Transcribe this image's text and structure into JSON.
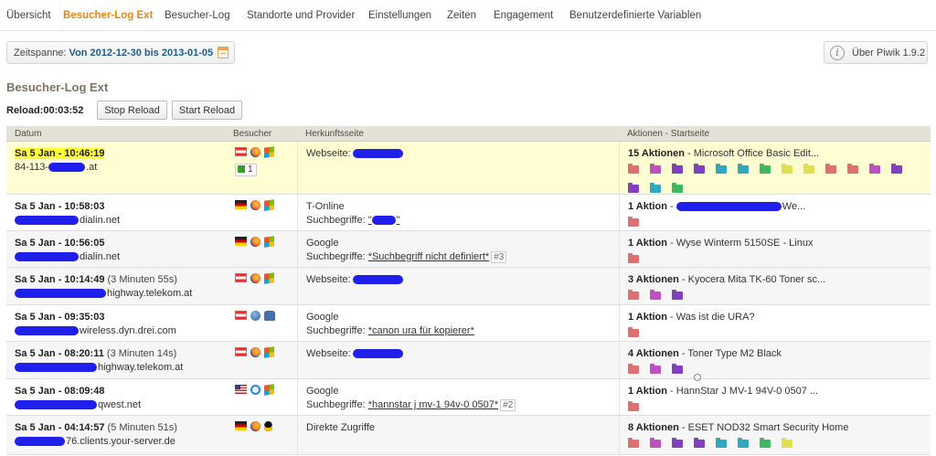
{
  "nav": {
    "tabs": [
      {
        "label": "Übersicht"
      },
      {
        "label": "Besucher-Log Ext"
      },
      {
        "label": "Besucher-Log"
      },
      {
        "label": "Standorte und Provider"
      },
      {
        "label": "Einstellungen"
      },
      {
        "label": "Zeiten"
      },
      {
        "label": "Engagement"
      },
      {
        "label": "Benutzerdefinierte Variablen"
      }
    ],
    "active_tab": "Besucher-Log Ext"
  },
  "period": {
    "label": "Zeitspanne:",
    "value": "Von 2012-12-30 bis 2013-01-05",
    "icon": "calendar-icon"
  },
  "about": {
    "label": "Über Piwik 1.9.2",
    "icon": "info-icon"
  },
  "title": "Besucher-Log Ext",
  "reload": {
    "label": "Reload:",
    "timer": "00:03:52",
    "stop_label": "Stop Reload",
    "start_label": "Start Reload"
  },
  "table": {
    "columns": [
      "Datum",
      "Besucher",
      "Herkunftsseite",
      "Aktionen - Startseite"
    ],
    "rows": [
      {
        "date": "Sa 5 Jan - 10:46:19",
        "duration": "",
        "host": "84-113-",
        "host_suffix": ".at",
        "icons": [
          "flag-at",
          "firefox-icon",
          "windows-icon"
        ],
        "goal": "1",
        "ref_type": "Webseite:",
        "ref_detail": "",
        "keyword": "",
        "pos": "",
        "actions": "15 Aktionen",
        "action_title": "Microsoft Office Basic Edit...",
        "folders": [
          "#e07070",
          "#c050c0",
          "#8040c0",
          "#8040c0",
          "#30a8c0",
          "#30a8c0",
          "#40b860",
          "#e0e050",
          "#e0e050",
          "#e07070",
          "#e07070",
          "#c050c0",
          "#8040c0",
          "#8040c0",
          "#30a8c0",
          "#40b860"
        ],
        "magnifier": false
      },
      {
        "date": "Sa 5 Jan - 10:58:03",
        "duration": "",
        "host": "",
        "host_suffix": "dialin.net",
        "icons": [
          "flag-de",
          "firefox-icon",
          "windows-icon"
        ],
        "goal": "",
        "ref_type": "T-Online",
        "ref_detail": "Suchbegriffe:",
        "keyword": "",
        "pos": "",
        "actions": "1 Aktion",
        "action_title": "We...",
        "folders": [
          "#e07070"
        ],
        "magnifier": false
      },
      {
        "date": "Sa 5 Jan - 10:56:05",
        "duration": "",
        "host": "",
        "host_suffix": "dialin.net",
        "icons": [
          "flag-de",
          "firefox-icon",
          "windows-icon"
        ],
        "goal": "",
        "ref_type": "Google",
        "ref_detail": "Suchbegriffe:",
        "keyword": "*Suchbegriff nicht definiert*",
        "pos": "3",
        "actions": "1 Aktion",
        "action_title": "Wyse Winterm 5150SE - Linux",
        "folders": [
          "#e07070"
        ],
        "magnifier": false
      },
      {
        "date": "Sa 5 Jan - 10:14:49",
        "duration": "(3 Minuten 55s)",
        "host": "",
        "host_suffix": "highway.telekom.at",
        "icons": [
          "flag-at",
          "firefox-icon",
          "windows-icon"
        ],
        "goal": "",
        "ref_type": "Webseite:",
        "ref_detail": "",
        "keyword": "",
        "pos": "",
        "actions": "3 Aktionen",
        "action_title": "Kyocera Mita TK-60 Toner sc...",
        "folders": [
          "#e07070",
          "#c050c0",
          "#8040c0"
        ],
        "magnifier": false
      },
      {
        "date": "Sa 5 Jan - 09:35:03",
        "duration": "",
        "host": "",
        "host_suffix": "wireless.dyn.drei.com",
        "icons": [
          "flag-at",
          "globe-icon",
          "android-icon"
        ],
        "goal": "",
        "ref_type": "Google",
        "ref_detail": "Suchbegriffe:",
        "keyword": "*canon ura für kopierer*",
        "pos": "",
        "actions": "1 Aktion",
        "action_title": "Was ist die URA?",
        "folders": [
          "#e07070"
        ],
        "magnifier": false
      },
      {
        "date": "Sa 5 Jan - 08:20:11",
        "duration": "(3 Minuten 14s)",
        "host": "",
        "host_suffix": "highway.telekom.at",
        "icons": [
          "flag-at",
          "firefox-icon",
          "windows-icon"
        ],
        "goal": "",
        "ref_type": "Webseite:",
        "ref_detail": "",
        "keyword": "",
        "pos": "",
        "actions": "4 Aktionen",
        "action_title": "Toner Type M2 Black",
        "folders": [
          "#e07070",
          "#c050c0",
          "#8040c0"
        ],
        "magnifier": true
      },
      {
        "date": "Sa 5 Jan - 08:09:48",
        "duration": "",
        "host": "",
        "host_suffix": "qwest.net",
        "icons": [
          "flag-us",
          "ie-icon",
          "windows-icon"
        ],
        "goal": "",
        "ref_type": "Google",
        "ref_detail": "Suchbegriffe:",
        "keyword": "*hannstar j mv-1 94v-0 0507*",
        "pos": "2",
        "actions": "1 Aktion",
        "action_title": "HannStar J MV-1 94V-0 0507 ...",
        "folders": [
          "#e07070"
        ],
        "magnifier": false
      },
      {
        "date": "Sa 5 Jan - 04:14:57",
        "duration": "(5 Minuten 51s)",
        "host": "",
        "host_suffix": "76.clients.your-server.de",
        "icons": [
          "flag-de",
          "firefox-icon",
          "linux-icon"
        ],
        "goal": "",
        "ref_type": "Direkte Zugriffe",
        "ref_detail": "",
        "keyword": "",
        "pos": "",
        "actions": "8 Aktionen",
        "action_title": "ESET NOD32 Smart Security Home",
        "folders": [
          "#e07070",
          "#c050c0",
          "#8040c0",
          "#8040c0",
          "#30a8c0",
          "#30a8c0",
          "#40b860",
          "#e0e050"
        ],
        "magnifier": false
      }
    ]
  }
}
